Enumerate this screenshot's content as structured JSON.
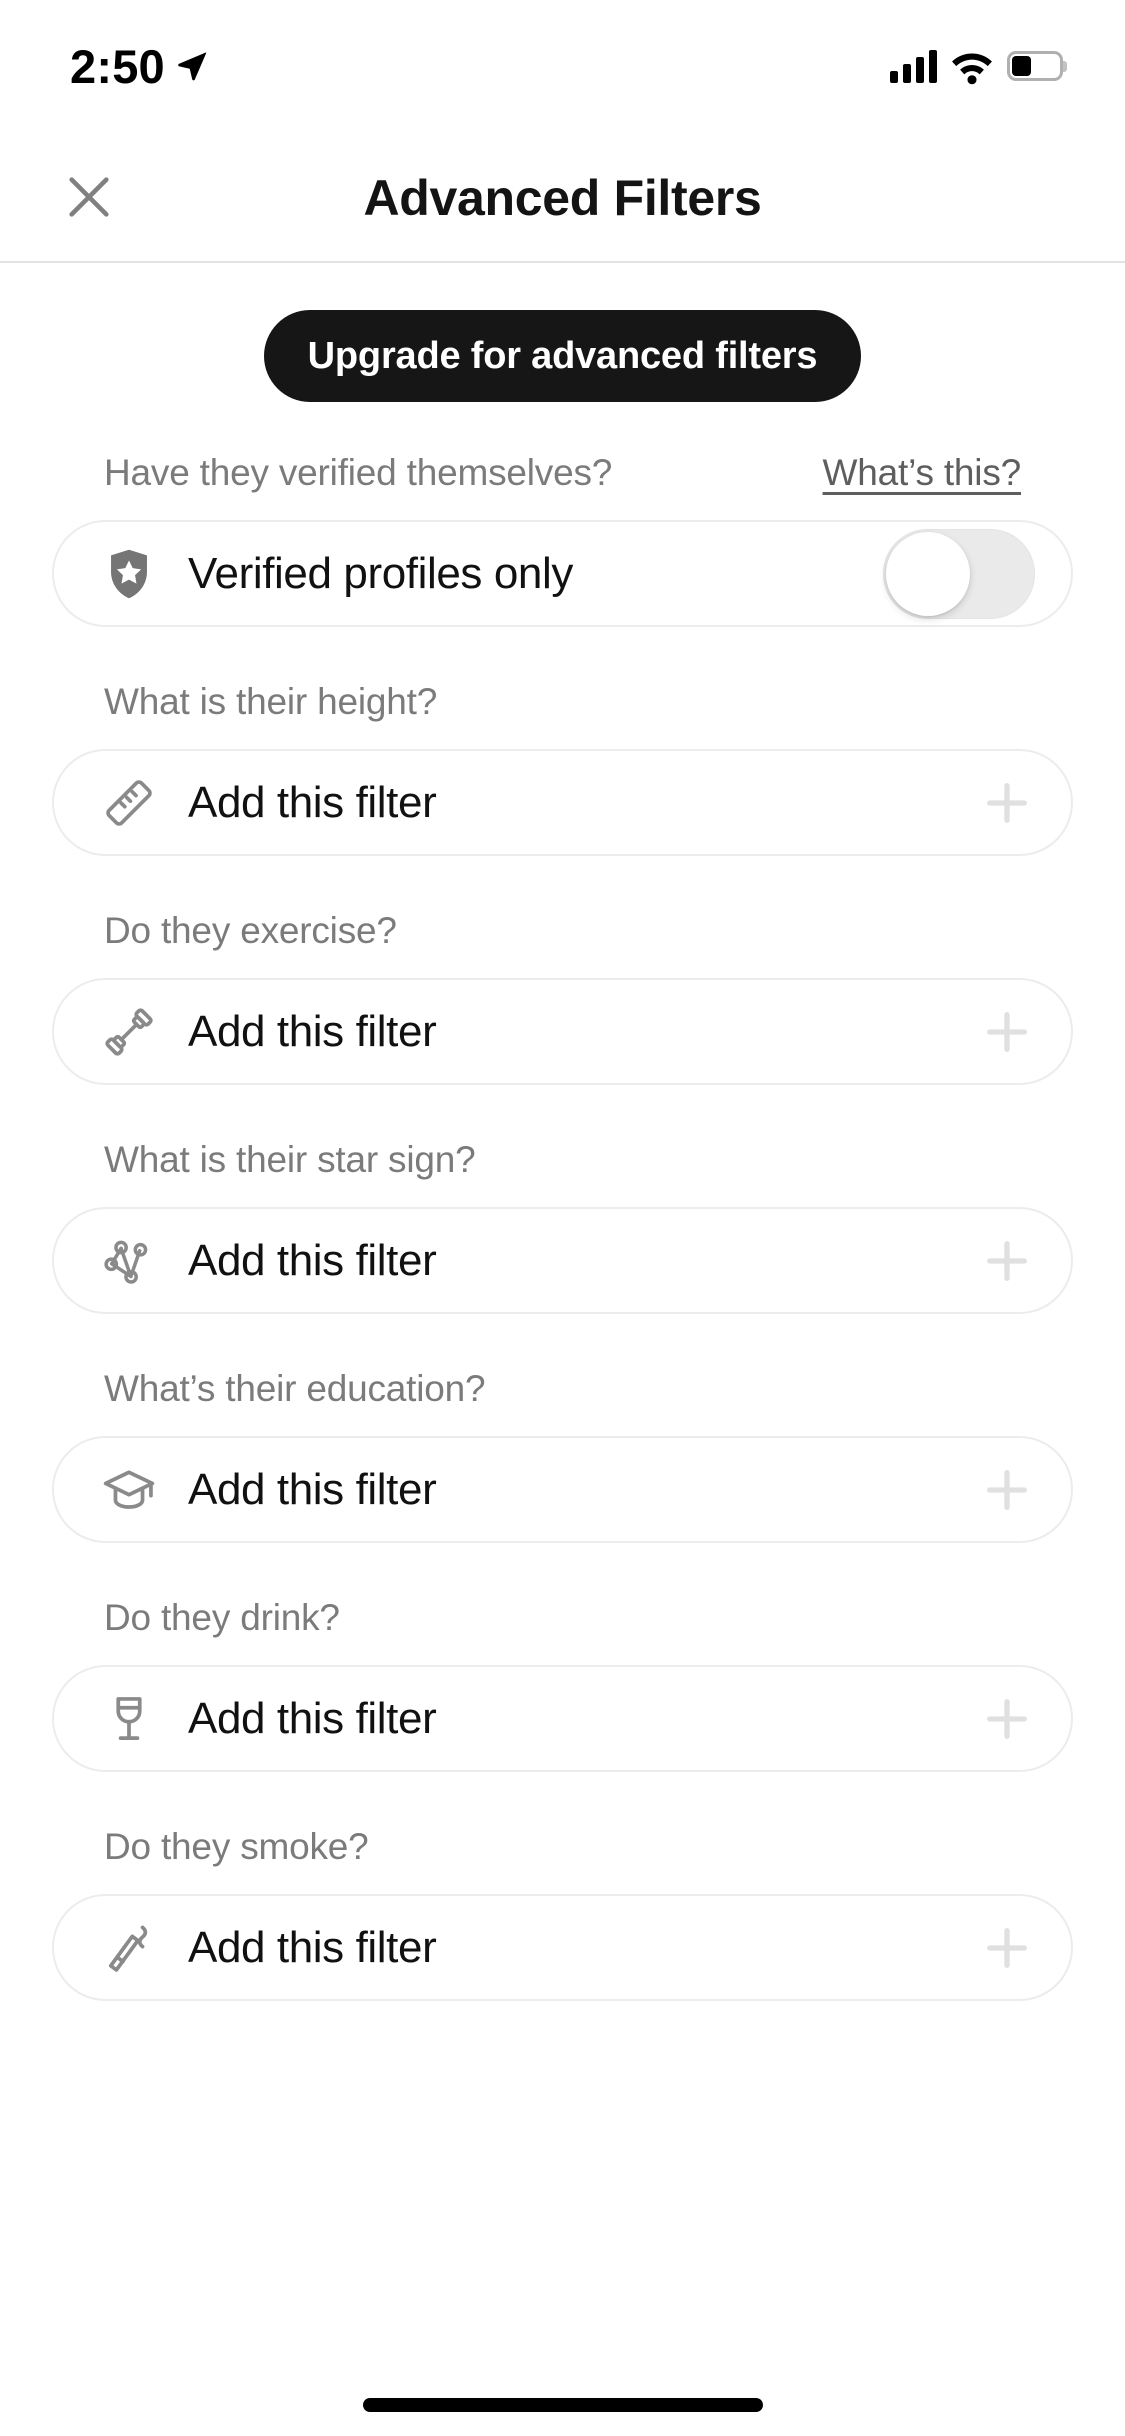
{
  "status_bar": {
    "time": "2:50",
    "location_icon": "location-arrow-icon",
    "signal_icon": "cellular-signal-icon",
    "wifi_icon": "wifi-icon",
    "battery_icon": "battery-icon",
    "battery_level_percent": 40
  },
  "header": {
    "close_icon": "close-icon",
    "title": "Advanced Filters"
  },
  "upgrade_banner": {
    "label": "Upgrade for advanced filters",
    "background_color": "#161616",
    "text_color": "#ffffff"
  },
  "verified_section": {
    "question": "Have they verified themselves?",
    "info_link": "What’s this?",
    "row_label": "Verified profiles only",
    "row_icon": "verified-shield-star-icon",
    "toggle_state": "off",
    "toggle_track_color": "#eaeaea",
    "toggle_knob_color": "#ffffff"
  },
  "filters": [
    {
      "question": "What is their height?",
      "icon": "ruler-icon",
      "action_label": "Add this filter",
      "add_icon": "plus-icon"
    },
    {
      "question": "Do they exercise?",
      "icon": "dumbbell-icon",
      "action_label": "Add this filter",
      "add_icon": "plus-icon"
    },
    {
      "question": "What is their star sign?",
      "icon": "constellation-icon",
      "action_label": "Add this filter",
      "add_icon": "plus-icon"
    },
    {
      "question": "What’s their education?",
      "icon": "graduation-cap-icon",
      "action_label": "Add this filter",
      "add_icon": "plus-icon"
    },
    {
      "question": "Do they drink?",
      "icon": "wine-glass-icon",
      "action_label": "Add this filter",
      "add_icon": "plus-icon"
    },
    {
      "question": "Do they smoke?",
      "icon": "cigarette-icon",
      "action_label": "Add this filter",
      "add_icon": "plus-icon"
    }
  ],
  "colors": {
    "label_gray": "#7b7b7b",
    "icon_gray": "#8a8a8a",
    "card_border": "#ececec",
    "plus_gray": "#e0e0e0",
    "text_black": "#111111"
  },
  "home_indicator": "home-indicator"
}
